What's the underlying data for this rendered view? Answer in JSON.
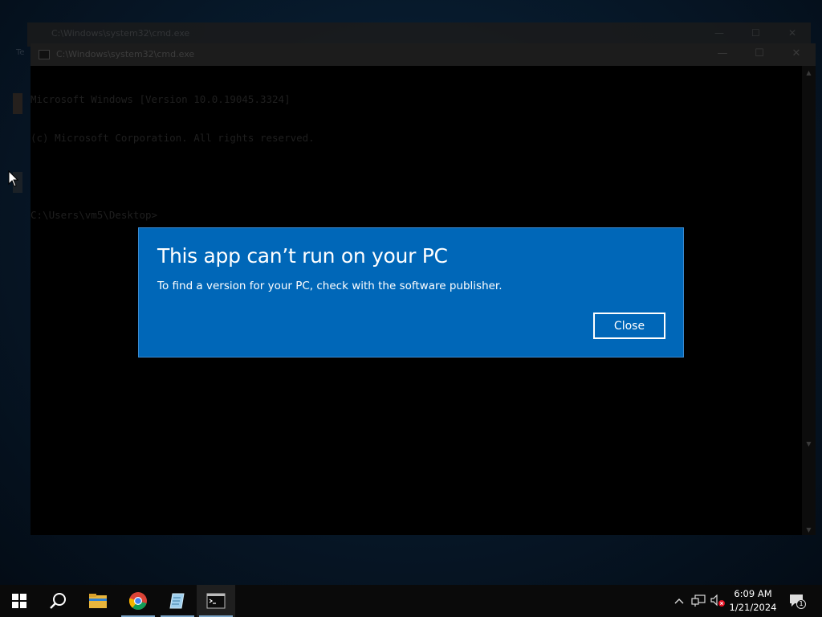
{
  "background_window": {
    "title": "C:\\Windows\\system32\\cmd.exe"
  },
  "cmd_window": {
    "title": "C:\\Windows\\system32\\cmd.exe",
    "lines": [
      "Microsoft Windows [Version 10.0.19045.3324]",
      "(c) Microsoft Corporation. All rights reserved.",
      "",
      "C:\\Users\\vm5\\Desktop>"
    ]
  },
  "dialog": {
    "heading": "This app can’t run on your PC",
    "message": "To find a version for your PC, check with the software publisher.",
    "close_label": "Close",
    "bg_color": "#0067b8"
  },
  "desktop": {
    "label_fragment": "Te"
  },
  "taskbar": {
    "clock_time": "6:09 AM",
    "clock_date": "1/21/2024",
    "notification_count": "1",
    "items": [
      "start-icon",
      "search-icon",
      "file-explorer-icon",
      "chrome-icon",
      "notepad-icon",
      "cmd-icon"
    ]
  }
}
